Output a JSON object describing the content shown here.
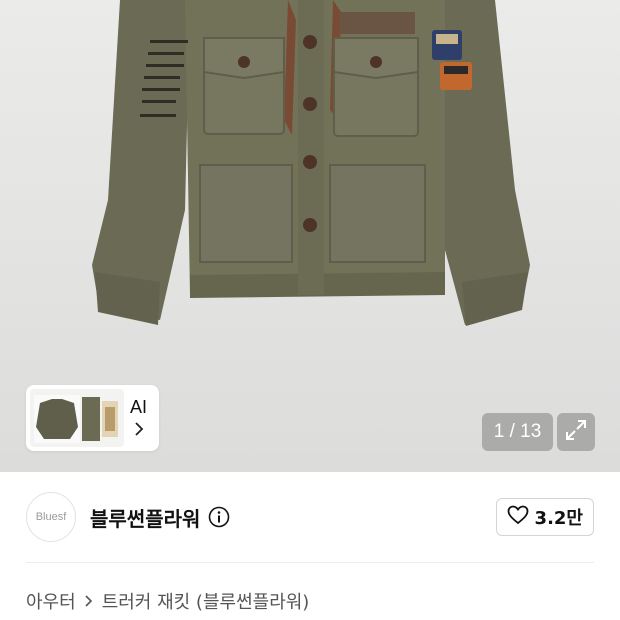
{
  "gallery": {
    "counter": "1 / 13",
    "ai_label": "AI",
    "icons": {
      "chevron": "chevron-right-icon",
      "expand": "expand-icon"
    }
  },
  "brand": {
    "logo_text": "Bluesf",
    "name": "블루썬플라워",
    "info_icon": "info-icon"
  },
  "like": {
    "count": "3.2만",
    "icon": "heart-icon"
  },
  "breadcrumb": {
    "category": "아우터",
    "subcategory": "트러커 재킷 (블루썬플라워)"
  },
  "colors": {
    "jacket": "#6e6e58",
    "button_brown": "#5a3a2c",
    "counter_bg": "#828282"
  }
}
